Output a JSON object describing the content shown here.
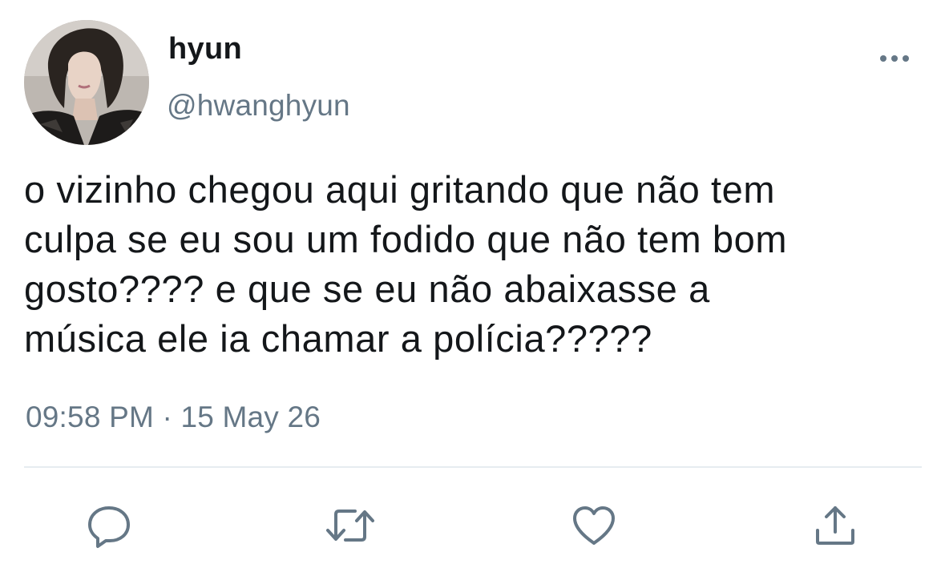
{
  "user": {
    "display_name": "hyun",
    "handle": "@hwanghyun"
  },
  "tweet": {
    "text": "o vizinho chegou aqui gritando que não tem\nculpa se eu sou um fodido que não tem bom\ngosto???? e que se eu não abaixasse a\nmúsica ele ia chamar a polícia?????",
    "timestamp": "09:58 PM · 15 May 26"
  },
  "actions": [
    {
      "name": "reply",
      "icon": "speech-bubble-icon"
    },
    {
      "name": "retweet",
      "icon": "retweet-icon"
    },
    {
      "name": "like",
      "icon": "heart-icon"
    },
    {
      "name": "share",
      "icon": "share-upload-icon"
    }
  ],
  "colors": {
    "text_primary": "#14171a",
    "text_secondary": "#657786",
    "icon_gray": "#657786",
    "divider": "#e6ecf0",
    "background": "#ffffff"
  }
}
